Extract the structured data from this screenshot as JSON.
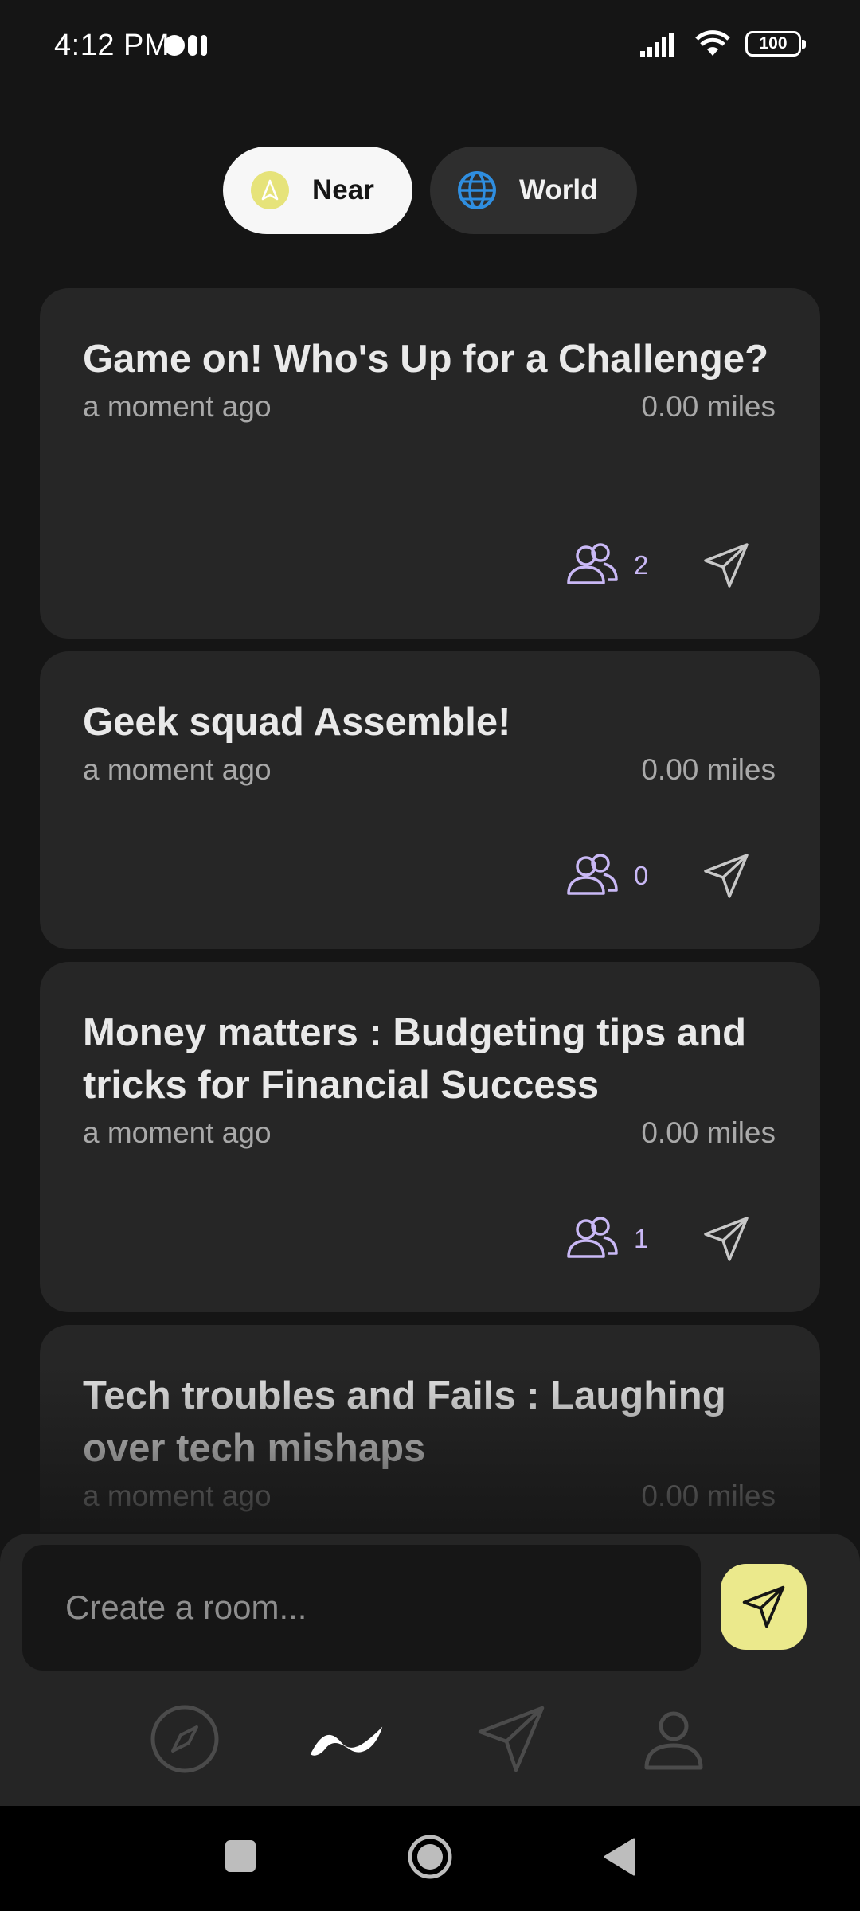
{
  "status_bar": {
    "time": "4:12 PM",
    "battery": "100"
  },
  "toggle": {
    "near": {
      "label": "Near",
      "icon": "navigation-arrow-icon",
      "active": true
    },
    "world": {
      "label": "World",
      "icon": "globe-icon",
      "active": false
    }
  },
  "rooms": [
    {
      "title": "Game on! Who's Up for a Challenge?",
      "time": "a moment ago",
      "distance": "0.00 miles",
      "members": "2"
    },
    {
      "title": "Geek squad Assemble!",
      "time": "a moment ago",
      "distance": "0.00 miles",
      "members": "0"
    },
    {
      "title": "Money matters : Budgeting tips and tricks for Financial Success",
      "time": "a moment ago",
      "distance": "0.00 miles",
      "members": "1"
    },
    {
      "title": "Tech troubles and Fails : Laughing over tech mishaps",
      "time": "a moment ago",
      "distance": "0.00 miles"
    }
  ],
  "composer": {
    "placeholder": "Create a room..."
  },
  "nav": [
    {
      "name": "explore",
      "icon": "compass-icon",
      "active": false
    },
    {
      "name": "feed",
      "icon": "wave-icon",
      "active": true
    },
    {
      "name": "messages",
      "icon": "send-icon",
      "active": false
    },
    {
      "name": "profile",
      "icon": "user-icon",
      "active": false
    }
  ],
  "colors": {
    "background": "#151515",
    "card": "#262626",
    "accent": "#ebe98c",
    "members": "#c9b8f5"
  }
}
